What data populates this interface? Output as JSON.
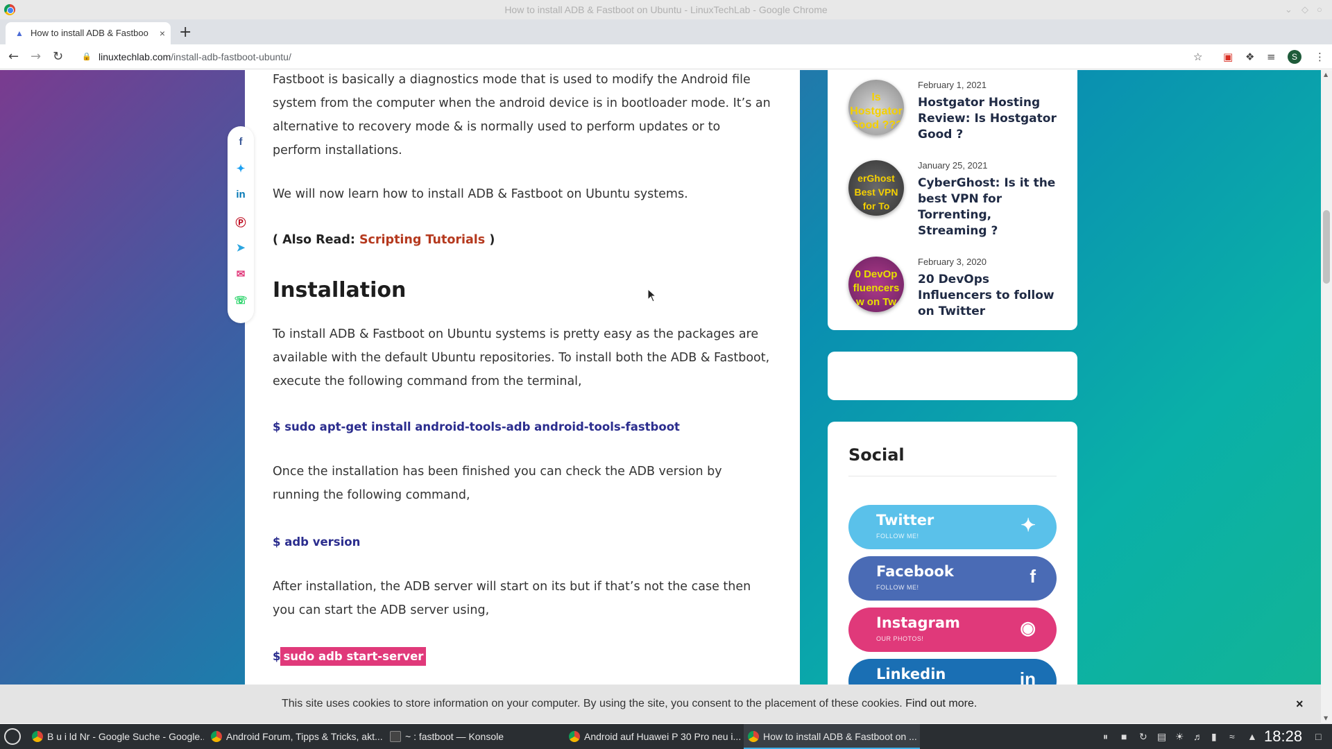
{
  "window": {
    "title": "How to install ADB & Fastboot on Ubuntu - LinuxTechLab - Google Chrome"
  },
  "tab": {
    "label": "How to install ADB & Fastboo",
    "close": "×",
    "new": "+"
  },
  "toolbar": {
    "url_host": "linuxtechlab.com",
    "url_path": "/install-adb-fastboot-ubuntu/",
    "avatar": "S"
  },
  "article": {
    "p1": "Fastboot is basically a diagnostics mode that is used to modify the Android file system from the computer when the android device is in bootloader mode. It’s an alternative to recovery mode & is normally used to perform updates or to perform installations.",
    "p2": "We will now learn how to install ADB & Fastboot on Ubuntu systems.",
    "also_prefix": "( Also Read: ",
    "also_link": "Scripting Tutorials",
    "also_suffix": " )",
    "heading": "Installation",
    "p3": "To install ADB & Fastboot on Ubuntu systems is pretty easy as the packages are available with the default Ubuntu repositories. To install both the ADB & Fastboot, execute the following command from the terminal,",
    "cmd1": "$ sudo apt-get install android-tools-adb android-tools-fastboot",
    "p4": "Once the installation has been finished you can check the ADB version by running the following command,",
    "cmd2": "$ adb version",
    "p5": "After installation, the ADB server will start on its but if that’s not the case then you can start the ADB server using,",
    "cmd3_prefix": "$",
    "cmd3_highlight": "sudo adb start-server"
  },
  "share_icons": [
    "facebook-icon",
    "twitter-icon",
    "linkedin-icon",
    "pinterest-icon",
    "telegram-icon",
    "email-icon",
    "whatsapp-icon"
  ],
  "recent_posts": [
    {
      "date": "February 1, 2021",
      "title": "Hostgator Hosting Review: Is Hostgator Good ?",
      "thumb_text": "Is Hostgator Good ???"
    },
    {
      "date": "January 25, 2021",
      "title": "CyberGhost: Is it the best VPN for Torrenting, Streaming ?",
      "thumb_text": "erGhost Best VPN for To"
    },
    {
      "date": "February 3, 2020",
      "title": "20 DevOps Influencers to follow on Twitter",
      "thumb_text": "0 DevOp fluencers w on Tw"
    }
  ],
  "social": {
    "title": "Social",
    "buttons": [
      {
        "name": "Twitter",
        "sub": "FOLLOW ME!",
        "icon": "twitter-icon",
        "color": "#5ac1ea"
      },
      {
        "name": "Facebook",
        "sub": "FOLLOW ME!",
        "icon": "facebook-icon",
        "color": "#4a6bb5"
      },
      {
        "name": "Instagram",
        "sub": "OUR PHOTOS!",
        "icon": "instagram-icon",
        "color": "#e0397a"
      },
      {
        "name": "Linkedin",
        "sub": "",
        "icon": "linkedin-icon",
        "color": "#1a6fb4"
      }
    ]
  },
  "cookie": {
    "text": "This site uses cookies to store information on your computer. By using the site, you consent to the placement of these cookies.",
    "link": "Find out more.",
    "close": "×"
  },
  "taskbar": {
    "tasks": [
      "B u i ld Nr - Google Suche - Google...",
      "Android Forum, Tipps & Tricks, akt...",
      "~ : fastboot — Konsole",
      "Android auf Huawei P 30 Pro neu i...",
      "How to install ADB & Fastboot on ..."
    ],
    "clock": "18:28"
  }
}
